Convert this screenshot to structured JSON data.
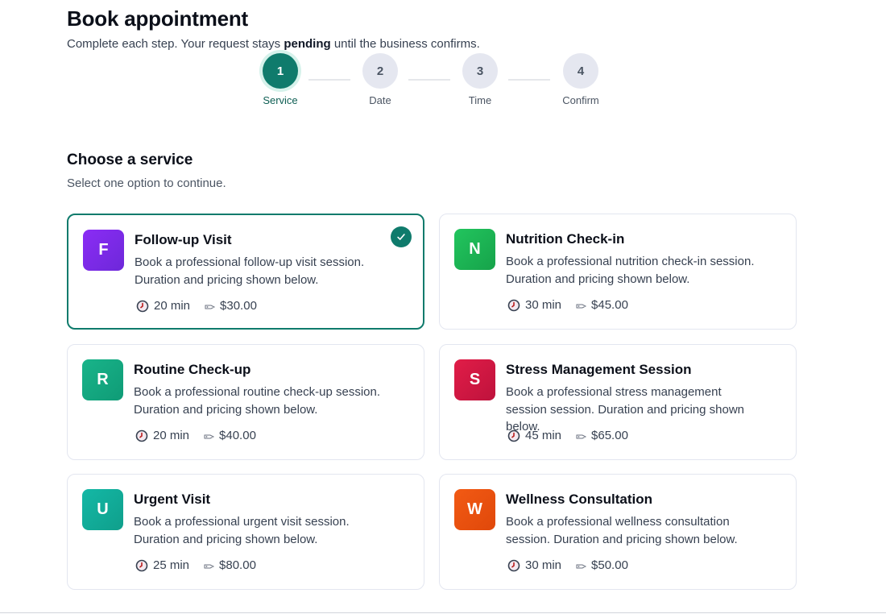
{
  "header": {
    "title": "Book appointment",
    "subtitle_prefix": "Complete each step. Your request stays ",
    "subtitle_emphasis": "pending",
    "subtitle_suffix": " until the business confirms."
  },
  "stepper": {
    "current_step": 1,
    "steps": [
      {
        "number": "1",
        "label": "Service"
      },
      {
        "number": "2",
        "label": "Date"
      },
      {
        "number": "3",
        "label": "Time"
      },
      {
        "number": "4",
        "label": "Confirm"
      }
    ]
  },
  "section": {
    "title": "Choose a service",
    "subtitle": "Select one option to continue."
  },
  "services": [
    {
      "initial": "F",
      "name": "Follow-up Visit",
      "description": "Book a professional follow-up visit session. Duration and pricing shown below.",
      "duration": "20 min",
      "price": "$30.00",
      "color": "#8b2cf5",
      "color2": "#6d28d9",
      "selected": true
    },
    {
      "initial": "N",
      "name": "Nutrition Check-in",
      "description": "Book a professional nutrition check-in session. Duration and pricing shown below.",
      "duration": "30 min",
      "price": "$45.00",
      "color": "#22c55e",
      "color2": "#16a34a",
      "selected": false
    },
    {
      "initial": "R",
      "name": "Routine Check-up",
      "description": "Book a professional routine check-up session. Duration and pricing shown below.",
      "duration": "20 min",
      "price": "$40.00",
      "color": "#19b48a",
      "color2": "#0f9b76",
      "selected": false
    },
    {
      "initial": "S",
      "name": "Stress Management Session",
      "description": "Book a professional stress management session session. Duration and pricing shown below.",
      "duration": "45 min",
      "price": "$65.00",
      "color": "#e11d48",
      "color2": "#be123c",
      "selected": false
    },
    {
      "initial": "U",
      "name": "Urgent Visit",
      "description": "Book a professional urgent visit session. Duration and pricing shown below.",
      "duration": "25 min",
      "price": "$80.00",
      "color": "#14b8a6",
      "color2": "#0f9f8b",
      "selected": false
    },
    {
      "initial": "W",
      "name": "Wellness Consultation",
      "description": "Book a professional wellness consultation session. Duration and pricing shown below.",
      "duration": "30 min",
      "price": "$50.00",
      "color": "#f25a14",
      "color2": "#e0480a",
      "selected": false
    }
  ],
  "colors": {
    "accent": "#0f7b6c",
    "card_border": "#e3e6f0"
  },
  "icons": {
    "duration": "clock-icon",
    "price": "tag-icon",
    "selected": "checkmark-icon"
  }
}
